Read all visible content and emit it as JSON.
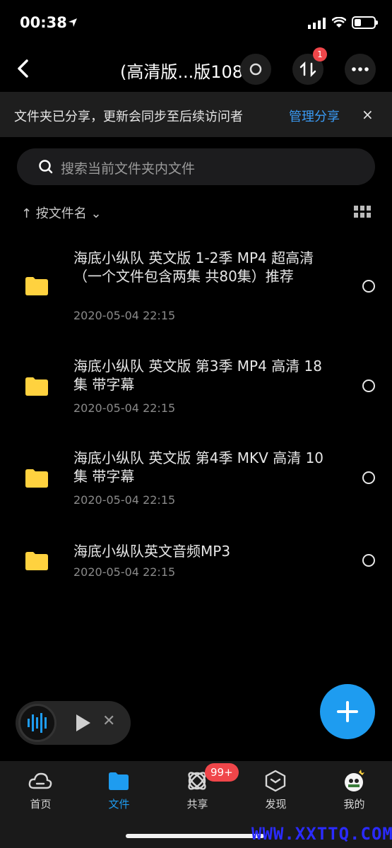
{
  "status_bar": {
    "time": "00:38"
  },
  "header": {
    "title": "(高清版...版108集",
    "badge": "1"
  },
  "share_banner": {
    "text": "文件夹已分享，更新会同步至后续访问者",
    "link": "管理分享",
    "close": "×"
  },
  "search": {
    "placeholder": "搜索当前文件夹内文件"
  },
  "sort": {
    "label": "↑ 按文件名 ⌄"
  },
  "files": [
    {
      "name": "海底小纵队 英文版 1-2季 MP4 超高清（一个文件包含两集 共80集）推荐",
      "date": "2020-05-04 22:15"
    },
    {
      "name": "海底小纵队 英文版 第3季 MP4 高清 18集 带字幕",
      "date": "2020-05-04 22:15"
    },
    {
      "name": "海底小纵队 英文版 第4季 MKV 高清 10集 带字幕",
      "date": "2020-05-04 22:15"
    },
    {
      "name": "海底小纵队英文音频MP3",
      "date": "2020-05-04 22:15"
    }
  ],
  "tabs": [
    {
      "label": "首页",
      "icon": "cloud-icon"
    },
    {
      "label": "文件",
      "icon": "folder-icon"
    },
    {
      "label": "共享",
      "icon": "share-orbit-icon"
    },
    {
      "label": "发现",
      "icon": "box-icon"
    },
    {
      "label": "我的",
      "icon": "avatar"
    }
  ],
  "tab_badge": "99+",
  "watermark": "WWW.XXTTQ.COM",
  "colors": {
    "accent": "#1e9cf0",
    "badge": "#f0464a",
    "folder": "#ffd23f",
    "link": "#3a9bf5"
  }
}
